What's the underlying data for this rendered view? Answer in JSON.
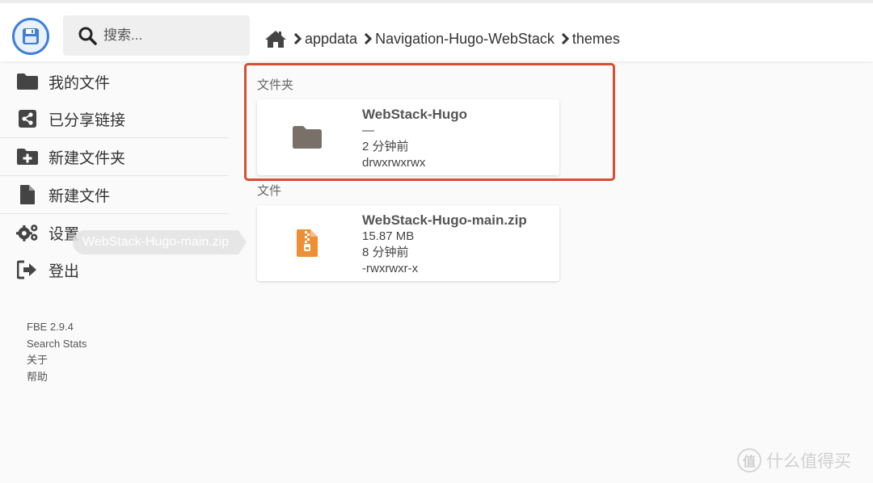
{
  "header": {
    "search_placeholder": "搜索...",
    "breadcrumbs": [
      "appdata",
      "Navigation-Hugo-WebStack",
      "themes"
    ]
  },
  "sidebar": {
    "items": [
      {
        "label": "我的文件",
        "icon": "folder-icon"
      },
      {
        "label": "已分享链接",
        "icon": "share-icon"
      },
      {
        "label": "新建文件夹",
        "icon": "new-folder-icon"
      },
      {
        "label": "新建文件",
        "icon": "new-file-icon"
      },
      {
        "label": "设置",
        "icon": "gears-icon"
      },
      {
        "label": "登出",
        "icon": "logout-icon"
      }
    ],
    "footer": [
      "FBE 2.9.4",
      "Search Stats",
      "关于",
      "帮助"
    ]
  },
  "tooltip": "WebStack-Hugo-main.zip",
  "main": {
    "folders_title": "文件夹",
    "files_title": "文件",
    "folders": [
      {
        "name": "WebStack-Hugo",
        "size": "—",
        "modified": "2 分钟前",
        "permissions": "drwxrwxrwx"
      }
    ],
    "files": [
      {
        "name": "WebStack-Hugo-main.zip",
        "size": "15.87 MB",
        "modified": "8 分钟前",
        "permissions": "-rwxrwxr-x"
      }
    ]
  },
  "watermark": {
    "icon_char": "值",
    "text": "什么值得买"
  },
  "colors": {
    "accent": "#3f7fd9",
    "highlight": "#d94e32",
    "zip": "#ef8e33",
    "folder": "#7a706a"
  }
}
